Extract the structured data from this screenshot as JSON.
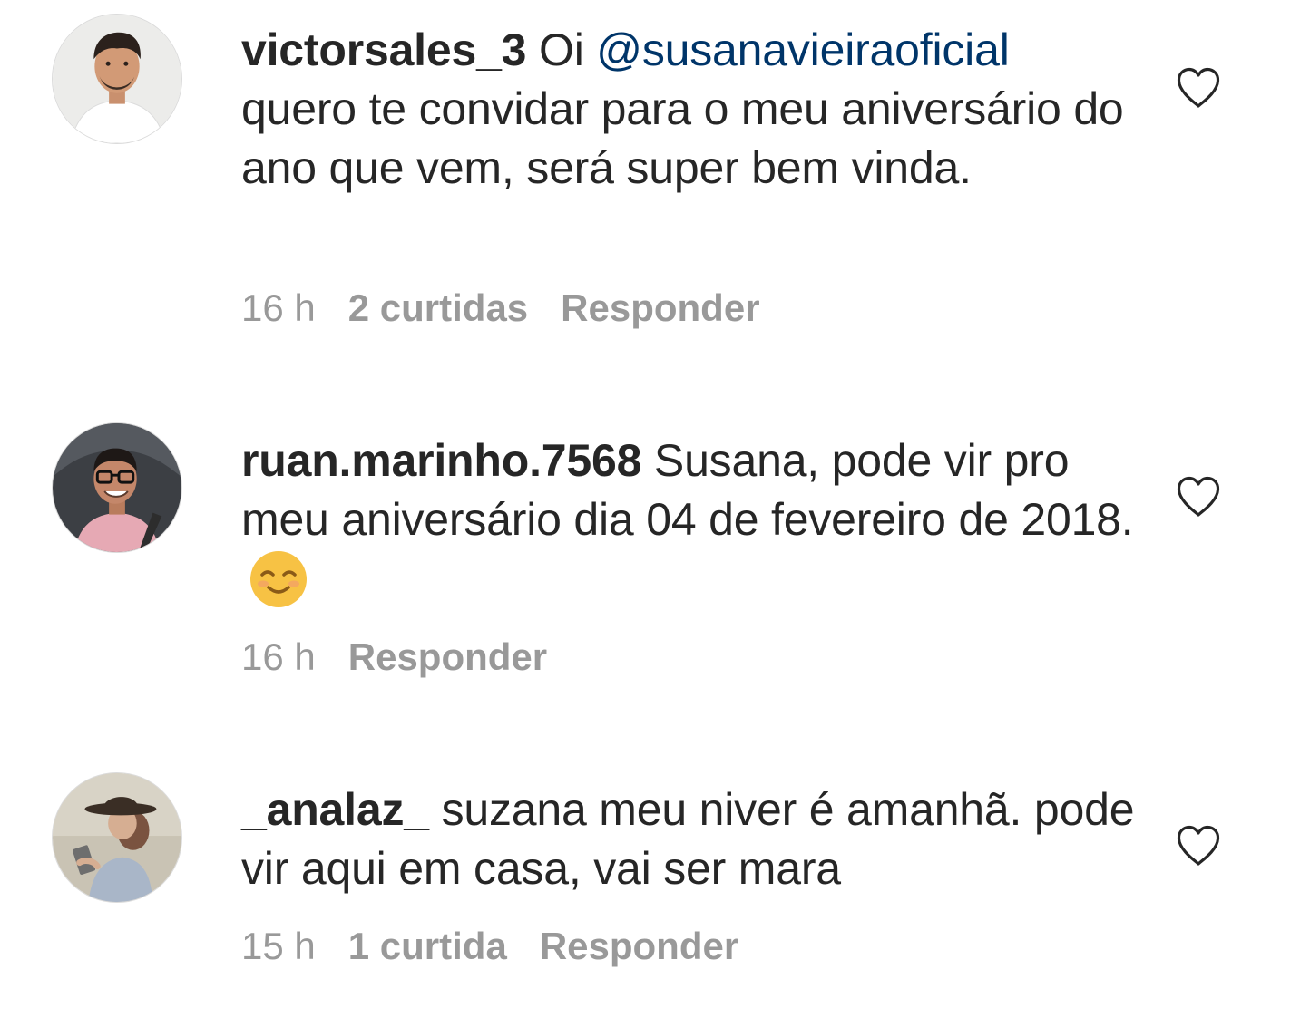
{
  "comments": [
    {
      "username": "victorsales_3",
      "text_before_mention": "Oi ",
      "mention": "@susanavieiraoficial",
      "text_after_mention": " quero te convidar para o meu aniversário do ano que vem, será super bem vinda.",
      "time": "16 h",
      "likes": "2 curtidas",
      "reply_label": "Responder",
      "avatar_icon": "profile-photo-man",
      "like_icon": "heart-outline-icon"
    },
    {
      "username": "ruan.marinho.7568",
      "text": "Susana, pode vir pro meu aniversário dia 04 de fevereiro de 2018.",
      "emoji": "smiling-face-emoji",
      "time": "16 h",
      "reply_label": "Responder",
      "avatar_icon": "profile-photo-man-glasses",
      "like_icon": "heart-outline-icon"
    },
    {
      "username": "_analaz_",
      "text": "suzana meu niver é amanhã. pode vir aqui em casa, vai ser mara",
      "time": "15 h",
      "likes": "1 curtida",
      "reply_label": "Responder",
      "avatar_icon": "profile-photo-woman-hat",
      "like_icon": "heart-outline-icon"
    }
  ],
  "colors": {
    "text": "#262626",
    "mention": "#003569",
    "meta": "#999999",
    "emoji_face": "#f7c244"
  }
}
